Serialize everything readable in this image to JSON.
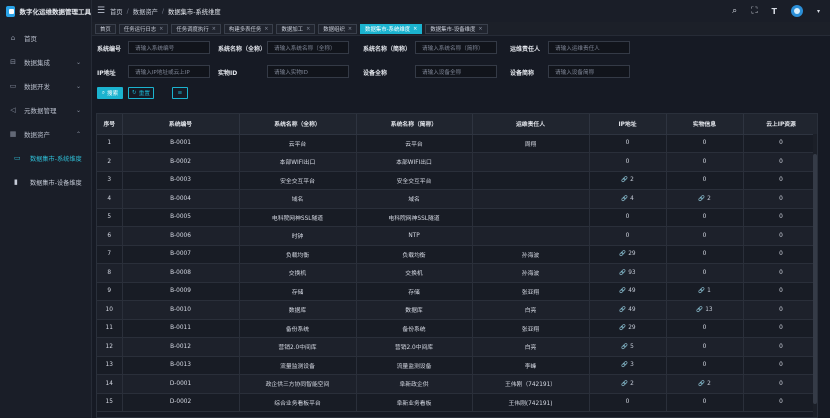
{
  "app": {
    "title": "数字化运维数据管理工具"
  },
  "sidebar": {
    "items": [
      {
        "label": "首页",
        "icon": "home-icon",
        "glyph": "⌂"
      },
      {
        "label": "数据集成",
        "icon": "integration-icon",
        "glyph": "⊟",
        "chevron": "⌄"
      },
      {
        "label": "数据开发",
        "icon": "dev-icon",
        "glyph": "▭",
        "chevron": "⌄"
      },
      {
        "label": "元数据管理",
        "icon": "metadata-icon",
        "glyph": "◁",
        "chevron": "⌄"
      },
      {
        "label": "数据资产",
        "icon": "asset-icon",
        "glyph": "▦",
        "chevron": "⌃"
      }
    ],
    "subitems": [
      {
        "label": "数据集市-系统维度",
        "glyph": "▭",
        "active": true
      },
      {
        "label": "数据集市-设备维度",
        "glyph": "▮",
        "active": false
      }
    ]
  },
  "header": {
    "menu_glyph": "☰",
    "breadcrumb": [
      "首页",
      "数据资产",
      "数据集市-系统维度"
    ],
    "sep": "/",
    "icons": {
      "search": "⌕",
      "fullscreen": "⛶",
      "font": "T"
    }
  },
  "tags": [
    {
      "label": "首页",
      "closable": false,
      "active": false
    },
    {
      "label": "任务运行日志",
      "closable": true,
      "active": false
    },
    {
      "label": "任务调度执行",
      "closable": true,
      "active": false
    },
    {
      "label": "构建多表任务",
      "closable": true,
      "active": false
    },
    {
      "label": "数据加工",
      "closable": true,
      "active": false
    },
    {
      "label": "数据组织",
      "closable": true,
      "active": false
    },
    {
      "label": "数据集市-系统维度",
      "closable": true,
      "active": true
    },
    {
      "label": "数据集市-设备维度",
      "closable": true,
      "active": false
    }
  ],
  "tag_close": "×",
  "form": {
    "row1": [
      {
        "label": "系统编号",
        "placeholder": "请输入系统编号"
      },
      {
        "label": "系统名称（全称）",
        "placeholder": "请输入系统名称（全称）"
      },
      {
        "label": "系统名称（简称）",
        "placeholder": "请输入系统名称（简称）"
      },
      {
        "label": "运维责任人",
        "placeholder": "请输入运维责任人"
      }
    ],
    "row2": [
      {
        "label": "IP地址",
        "placeholder": "请输入IP地址或云上IP"
      },
      {
        "label": "实物ID",
        "placeholder": "请输入实物ID"
      },
      {
        "label": "设备全称",
        "placeholder": "请输入设备全称"
      },
      {
        "label": "设备简称",
        "placeholder": "请输入设备简称"
      }
    ],
    "search_btn": "搜索",
    "reset_btn": "重置",
    "search_glyph": "⌕",
    "reset_glyph": "↻",
    "toggle_glyph": "≡"
  },
  "table": {
    "headers": [
      "序号",
      "系统编号",
      "系统名称（全称）",
      "系统名称（简称）",
      "运维责任人",
      "IP地址",
      "实物信息",
      "云上IP资源"
    ],
    "link_glyph": "🔗",
    "rows": [
      [
        "1",
        "B-0001",
        "云平台",
        "云平台",
        "周翔",
        "0",
        "0",
        "0"
      ],
      [
        "2",
        "B-0002",
        "本部WIFI出口",
        "本部WIFI出口",
        "",
        "0",
        "0",
        "0"
      ],
      [
        "3",
        "B-0003",
        "安全交互平台",
        "安全交互平台",
        "",
        "2",
        "0",
        "0"
      ],
      [
        "4",
        "B-0004",
        "域名",
        "域名",
        "",
        "4",
        "2",
        "0"
      ],
      [
        "5",
        "B-0005",
        "电科院网神SSL隧道",
        "电科院网神SSL隧道",
        "",
        "0",
        "0",
        "0"
      ],
      [
        "6",
        "B-0006",
        "时钟",
        "NTP",
        "",
        "0",
        "0",
        "0"
      ],
      [
        "7",
        "B-0007",
        "负载均衡",
        "负载均衡",
        "孙海波",
        "29",
        "0",
        "0"
      ],
      [
        "8",
        "B-0008",
        "交换机",
        "交换机",
        "孙海波",
        "93",
        "0",
        "0"
      ],
      [
        "9",
        "B-0009",
        "存储",
        "存储",
        "张亚翔",
        "49",
        "1",
        "0"
      ],
      [
        "10",
        "B-0010",
        "数据库",
        "数据库",
        "白亮",
        "49",
        "13",
        "0"
      ],
      [
        "11",
        "B-0011",
        "备份系统",
        "备份系统",
        "张亚翔",
        "29",
        "0",
        "0"
      ],
      [
        "12",
        "B-0012",
        "营销2.0中间库",
        "营销2.0中间库",
        "白亮",
        "5",
        "0",
        "0"
      ],
      [
        "13",
        "B-0013",
        "流量监测设备",
        "流量监测设备",
        "李峰",
        "3",
        "0",
        "0"
      ],
      [
        "14",
        "D-0001",
        "政企供三方协同智能空间",
        "阜新政企供",
        "王伟刚（742191）",
        "2",
        "2",
        "0"
      ],
      [
        "15",
        "D-0002",
        "综合业务看板平台",
        "阜新业务看板",
        "王伟刚(742191)",
        "0",
        "0",
        "0"
      ]
    ],
    "link_cols": [
      5,
      6
    ]
  }
}
